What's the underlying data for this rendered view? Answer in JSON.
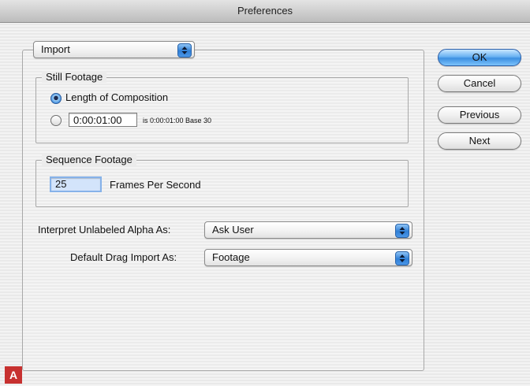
{
  "window": {
    "title": "Preferences"
  },
  "category_popup": {
    "value": "Import"
  },
  "still_footage": {
    "legend": "Still Footage",
    "option_length": "Length of Composition",
    "duration_value": "0:00:01:00",
    "duration_info": "is 0:00:01:00  Base 30"
  },
  "sequence_footage": {
    "legend": "Sequence Footage",
    "fps_value": "25",
    "fps_label": "Frames Per Second"
  },
  "alpha": {
    "label": "Interpret Unlabeled Alpha As:",
    "value": "Ask User"
  },
  "drag_import": {
    "label": "Default Drag Import As:",
    "value": "Footage"
  },
  "buttons": {
    "ok": "OK",
    "cancel": "Cancel",
    "previous": "Previous",
    "next": "Next"
  },
  "badge": "A",
  "colors": {
    "accent": "#3d8fe1",
    "badge": "#c73130"
  }
}
